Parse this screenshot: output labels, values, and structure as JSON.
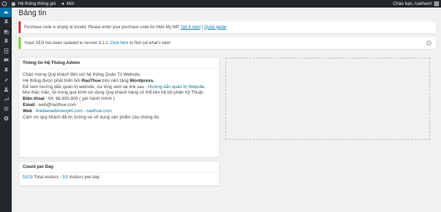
{
  "adminbar": {
    "site_name": "Hệ thống thông gió",
    "new_label": "Mới",
    "greeting": "Chào bạn, loathanh"
  },
  "page": {
    "title": "Bảng tin"
  },
  "notices": {
    "license": {
      "text": "Purchase code is empty or invalid. Please enter your purchase code for Hide My WP.",
      "link1": "Get it now!",
      "separator": "|",
      "link2": "Quick guide"
    },
    "yoast": {
      "text_before": "Yoast SEO has been updated to version 3.1.1.",
      "link": "Click here",
      "text_after": "to find out what's new!"
    }
  },
  "widget_admin": {
    "title": "Thông tin Hệ Thống Admin",
    "line1": "Chào mừng Quý khách đến với hệ thống Quản Trị Website.",
    "line2_pre": "Hệ thống được phát triển bởi",
    "line2_brand": "RaoThue",
    "line2_mid": "trên nền tảng",
    "line2_platform": "Wordpress.",
    "line3_pre": "Để xem hướng dẫn quản trị website, vui lòng xem tại link sau :",
    "line3_link": "Hướng dẫn quản trị Website.",
    "line4": "Mọi thắc mắc, lỗi trong quá trình sử dụng Quý khách hàng có thể liên hệ bộ phận Kỹ Thuật :",
    "phone_label": "Điện thoại",
    "phone_value": ": 04. 66.800.900 ( giờ hành chính )",
    "email_label": "Email",
    "email_value": ": web@raothue.com",
    "web_label": "Web",
    "web_sep": ":",
    "web_link1": "thietkewebmienphi.com",
    "web_dash": "-",
    "web_link2": "raothue.com",
    "line_thanks": "Cảm ơn quý khách đã tin tưởng và sử dụng sản phẩm của chúng tôi."
  },
  "widget_count": {
    "title": "Count per Day",
    "total_value": "5103",
    "total_label": "Total visitors -",
    "per_day_value": "53",
    "per_day_label": "Visitors per day"
  },
  "icons": [
    "dashboard-icon",
    "pin-icon",
    "media-icon",
    "pin-icon",
    "pages-icon",
    "comments-icon",
    "pin-icon",
    "appearance-icon",
    "users-icon",
    "tools-icon",
    "settings-icon",
    "collapse-icon"
  ],
  "colors": {
    "accent": "#0073aa",
    "error": "#dc3232",
    "success": "#7ad03a",
    "adminbar": "#23282d"
  }
}
